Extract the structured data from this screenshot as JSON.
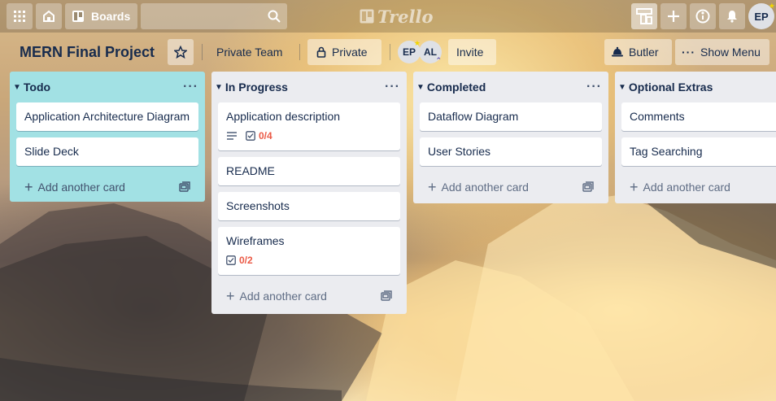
{
  "nav": {
    "apps_icon": "grid-icon",
    "home_icon": "home-icon",
    "boards_label": "Boards",
    "search_placeholder": "",
    "logo_text": "Trello",
    "user_initials": "EP"
  },
  "board": {
    "title": "MERN Final Project",
    "team": "Private Team",
    "visibility": "Private",
    "members": [
      "EP",
      "AL"
    ],
    "invite_label": "Invite",
    "butler_label": "Butler",
    "show_menu_label": "Show Menu"
  },
  "lists": [
    {
      "title": "Todo",
      "cards": [
        {
          "title": "Application Architecture Diagram"
        },
        {
          "title": "Slide Deck"
        }
      ],
      "add_label": "Add another card"
    },
    {
      "title": "In Progress",
      "cards": [
        {
          "title": "Application description",
          "checklist": "0/4"
        },
        {
          "title": "README"
        },
        {
          "title": "Screenshots"
        },
        {
          "title": "Wireframes",
          "checklist": "0/2"
        }
      ],
      "add_label": "Add another card"
    },
    {
      "title": "Completed",
      "cards": [
        {
          "title": "Dataflow Diagram"
        },
        {
          "title": "User Stories"
        }
      ],
      "add_label": "Add another card"
    },
    {
      "title": "Optional Extras",
      "cards": [
        {
          "title": "Comments"
        },
        {
          "title": "Tag Searching"
        }
      ],
      "add_label": "Add another card"
    }
  ],
  "colors": {
    "todo_list_bg": "#a2e1e4",
    "list_bg": "#ebecf0",
    "checklist_incomplete": "#eb5a46"
  }
}
